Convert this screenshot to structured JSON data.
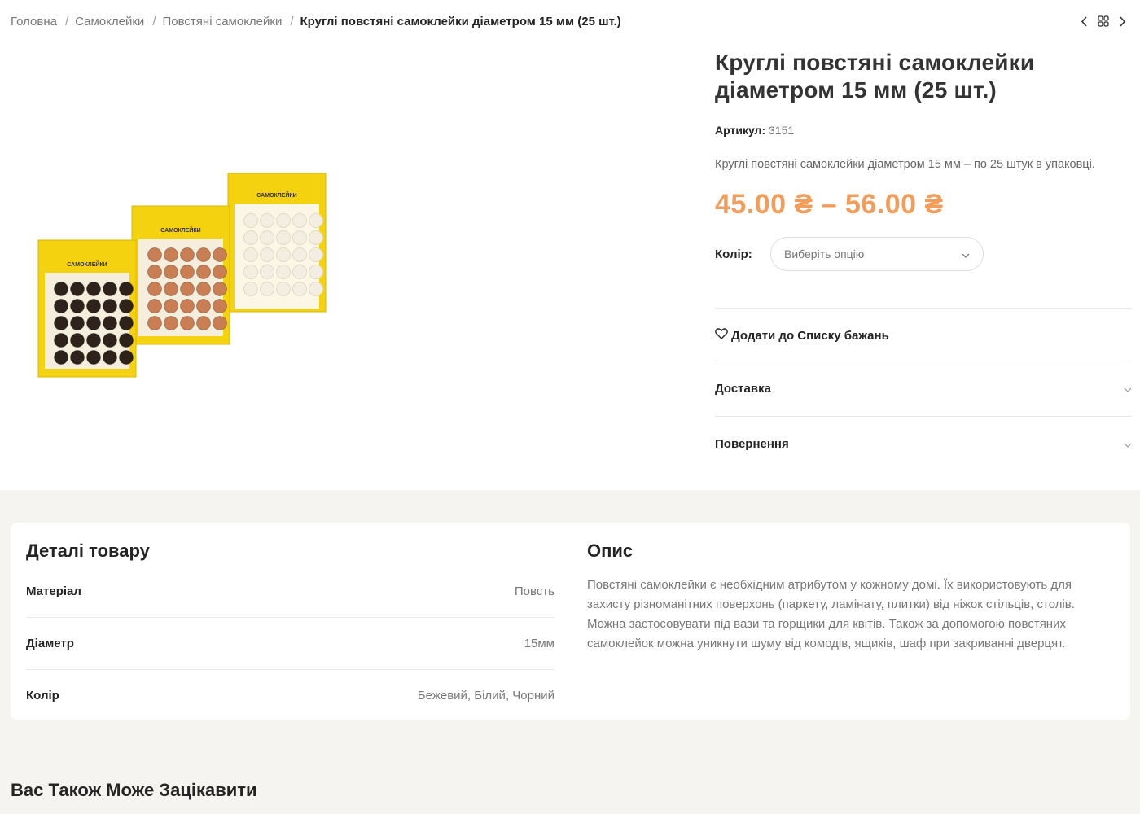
{
  "breadcrumb": {
    "items": [
      "Головна",
      "Самоклейки",
      "Повстяні самоклейки"
    ],
    "current": "Круглі повстяні самоклейки діаметром 15 мм (25 шт.)"
  },
  "nav": {
    "prev_icon": "chevron-left-icon",
    "grid_icon": "grid-icon",
    "next_icon": "chevron-right-icon"
  },
  "product": {
    "title": "Круглі повстяні самоклейки діаметром 15 мм (25 шт.)",
    "sku_label": "Артикул:",
    "sku_value": "3151",
    "short_description": "Круглі повстяні самоклейки діаметром 15 мм – по 25 штук в упаковці.",
    "price": "45.00 ₴ – 56.00 ₴",
    "price_color": "#f29d5c",
    "variation_label": "Колір:",
    "variation_placeholder": "Виберіть опцію",
    "wishlist_label": "Додати до Списку бажань",
    "accordions": [
      "Доставка",
      "Повернення"
    ]
  },
  "details": {
    "heading": "Деталі товару",
    "rows": [
      {
        "key": "Матеріал",
        "value": "Повсть"
      },
      {
        "key": "Діаметр",
        "value": "15мм"
      },
      {
        "key": "Колір",
        "value": "Бежевий, Білий, Чорний"
      }
    ]
  },
  "description": {
    "heading": "Опис",
    "text": "Повстяні самоклейки є необхідним атрибутом у кожному домі. Їх використовують для захисту різноманітних поверхонь (паркету, ламінату, плитки) від ніжок стільців, столів. Можна застосовувати під вази та горщики для квітів. Також за допомогою повстяних самоклейок можна уникнути шуму від комодів, ящиків, шаф при закриванні дверцят."
  },
  "related": {
    "heading": "Вас Також Може Зацікавити"
  },
  "image": {
    "packs": [
      {
        "label": "САМОКЛЕЙКИ",
        "dot_color": "#2e221b"
      },
      {
        "label": "САМОКЛЕЙКИ",
        "dot_color": "#c97e54"
      },
      {
        "label": "САМОКЛЕЙКИ",
        "dot_color": "#f4eee2"
      }
    ],
    "card_color": "#f5d20f"
  }
}
